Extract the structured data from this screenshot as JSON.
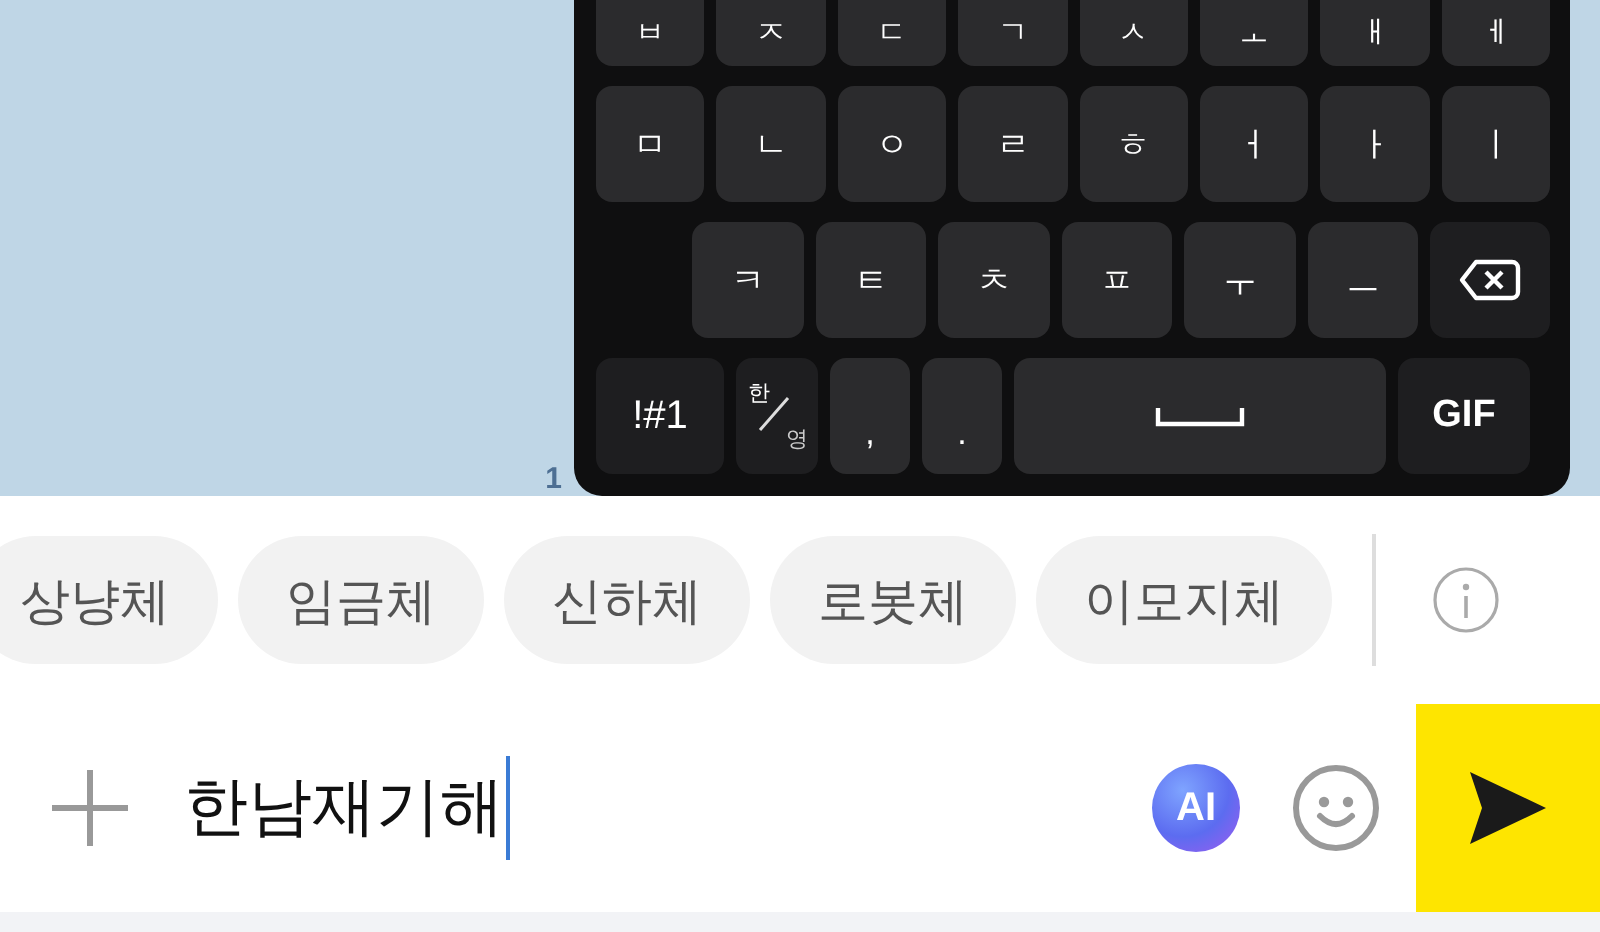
{
  "chat": {
    "unread_count": "1"
  },
  "keyboard": {
    "rows": [
      [
        {
          "kind": "char",
          "label": "ㅂ"
        },
        {
          "kind": "char",
          "label": "ㅈ"
        },
        {
          "kind": "char",
          "label": "ㄷ"
        },
        {
          "kind": "char",
          "label": "ㄱ"
        },
        {
          "kind": "char",
          "label": "ㅅ"
        },
        {
          "kind": "char",
          "label": "ㅗ"
        },
        {
          "kind": "char",
          "label": "ㅐ"
        },
        {
          "kind": "char",
          "label": "ㅔ"
        }
      ],
      [
        {
          "kind": "char",
          "label": "ㅁ"
        },
        {
          "kind": "char",
          "label": "ㄴ"
        },
        {
          "kind": "char",
          "label": "ㅇ"
        },
        {
          "kind": "char",
          "label": "ㄹ"
        },
        {
          "kind": "char",
          "label": "ㅎ"
        },
        {
          "kind": "char",
          "label": "ㅓ"
        },
        {
          "kind": "char",
          "label": "ㅏ"
        },
        {
          "kind": "char",
          "label": "ㅣ"
        }
      ],
      [
        {
          "kind": "char",
          "label": "ㅋ"
        },
        {
          "kind": "char",
          "label": "ㅌ"
        },
        {
          "kind": "char",
          "label": "ㅊ"
        },
        {
          "kind": "char",
          "label": "ㅍ"
        },
        {
          "kind": "char",
          "label": "ㅜ"
        },
        {
          "kind": "char",
          "label": "ㅡ"
        },
        {
          "kind": "backspace"
        }
      ],
      [
        {
          "kind": "symbols",
          "label": "!#1"
        },
        {
          "kind": "lang",
          "top": "한",
          "bottom": "영"
        },
        {
          "kind": "char",
          "label": ","
        },
        {
          "kind": "char",
          "label": "."
        },
        {
          "kind": "space"
        },
        {
          "kind": "gif",
          "label": "GIF"
        }
      ]
    ]
  },
  "font_chips": [
    {
      "label": "상냥체"
    },
    {
      "label": "임금체"
    },
    {
      "label": "신하체"
    },
    {
      "label": "로봇체"
    },
    {
      "label": "이모지체"
    }
  ],
  "input": {
    "value": "한남재기해",
    "ai_label": "AI"
  }
}
